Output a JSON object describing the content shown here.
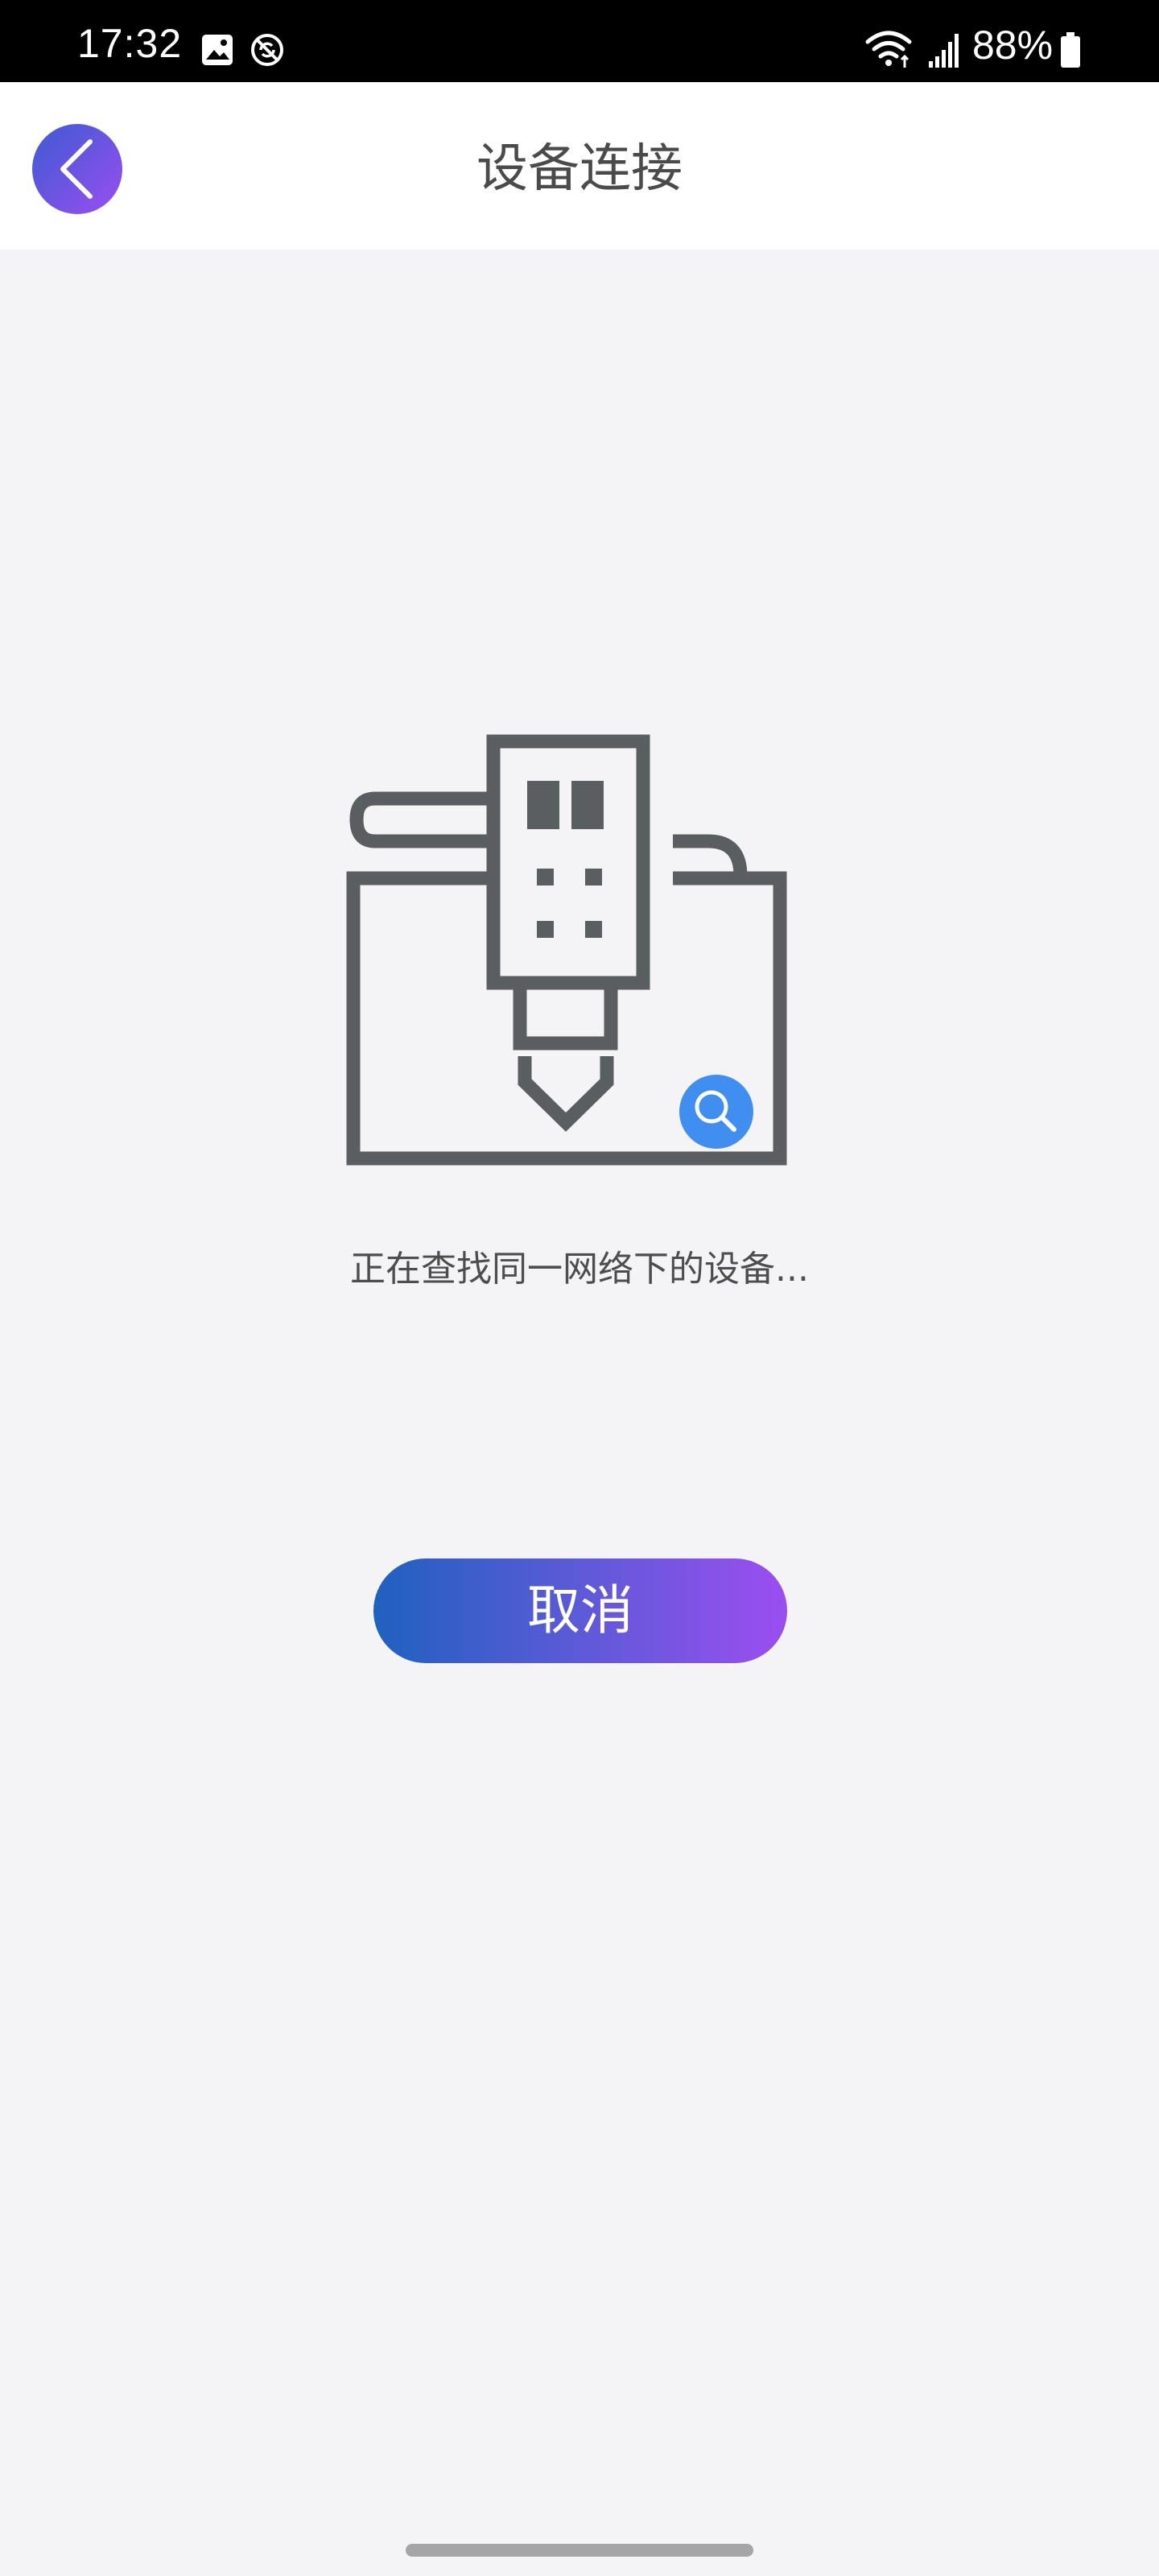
{
  "status_bar": {
    "time": "17:32",
    "battery": "88%",
    "icons": [
      "gallery-icon",
      "no-data-sync-icon",
      "wifi-icon",
      "signal-icon",
      "battery-icon"
    ]
  },
  "header": {
    "title": "设备连接",
    "back_icon": "chevron-left-icon"
  },
  "main": {
    "illustration": "device-search-illustration",
    "status_text": "正在查找同一网络下的设备...",
    "cancel_label": "取消"
  },
  "colors": {
    "background": "#f4f3f6",
    "gradient_start": "#1f61bf",
    "gradient_end": "#9b4ef0",
    "search_badge": "#3f8ef0",
    "icon_stroke": "#5b5e61"
  }
}
